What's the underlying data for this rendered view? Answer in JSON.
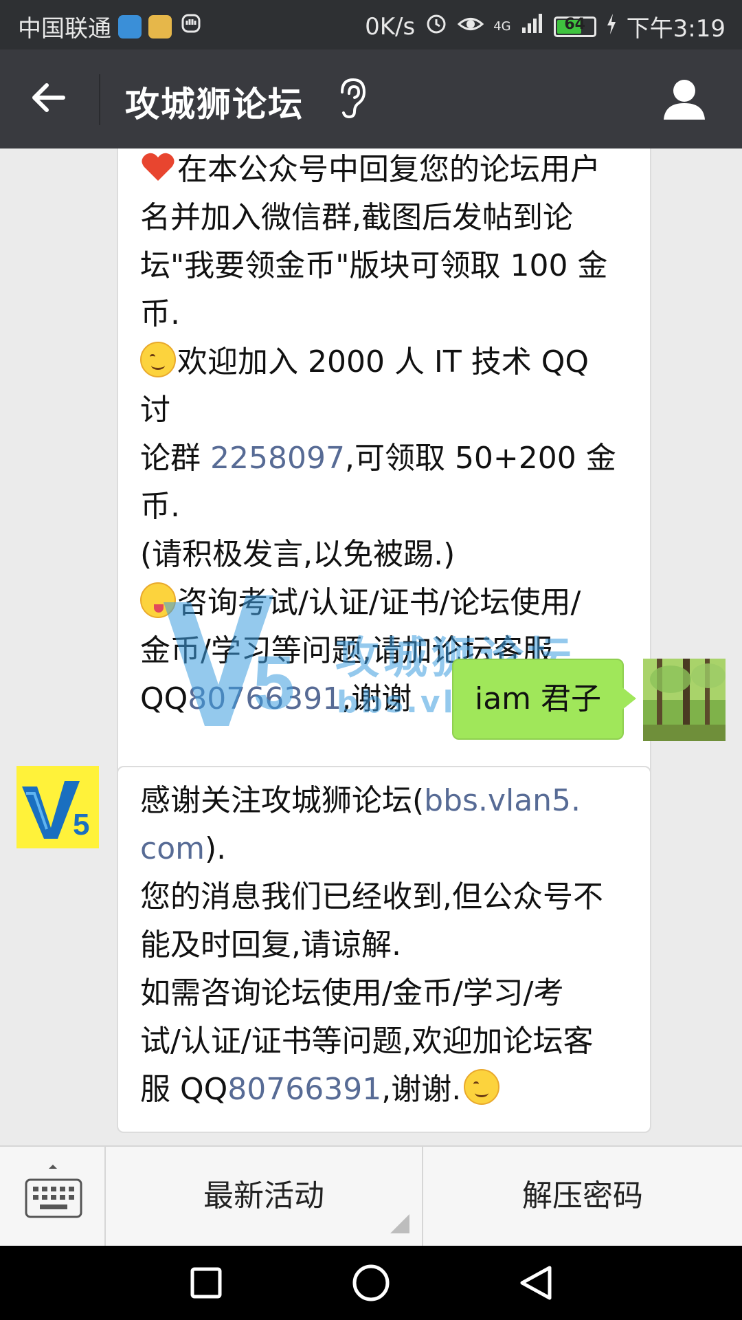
{
  "status_bar": {
    "carrier": "中国联通",
    "speed": "0K/s",
    "network": "4G",
    "battery": "64",
    "time": "下午3:19"
  },
  "header": {
    "title": "攻城狮论坛"
  },
  "messages": {
    "m1": {
      "l1": "在本公众号中回复您的论坛用户",
      "l2": "名并加入微信群,截图后发帖到论",
      "l3": "坛\"我要领金币\"版块可领取 100 金",
      "l4": "币.",
      "l5": "欢迎加入 2000 人 IT 技术 QQ 讨",
      "l6a": "论群 ",
      "l6link": "2258097",
      "l6b": ",可领取 50+200 金币.",
      "l7": "(请积极发言,以免被踢.)",
      "l8": "咨询考试/认证/证书/论坛使用/",
      "l9": "金币/学习等问题,请加论坛客服",
      "l10a": "QQ",
      "l10link": "80766391",
      "l10b": ",谢谢"
    },
    "m2": {
      "text": "iam 君子"
    },
    "m3": {
      "l1a": "感谢关注攻城狮论坛(",
      "l1link": "bbs.vlan5.",
      "l2link": "com",
      "l2b": ").",
      "l3": "您的消息我们已经收到,但公众号不",
      "l4": "能及时回复,请谅解.",
      "l5": "如需咨询论坛使用/金币/学习/考",
      "l6": "试/认证/证书等问题,欢迎加论坛客",
      "l7a": "服 QQ",
      "l7link": "80766391",
      "l7b": ",谢谢."
    }
  },
  "watermark": {
    "name": "攻城狮论坛",
    "url": "bbs.vlan5.com"
  },
  "bottom_menu": {
    "item1": "最新活动",
    "item2": "解压密码"
  },
  "colors": {
    "link": "#576b95",
    "sent_bubble": "#a0e75a",
    "navbar": "#393a3f"
  }
}
